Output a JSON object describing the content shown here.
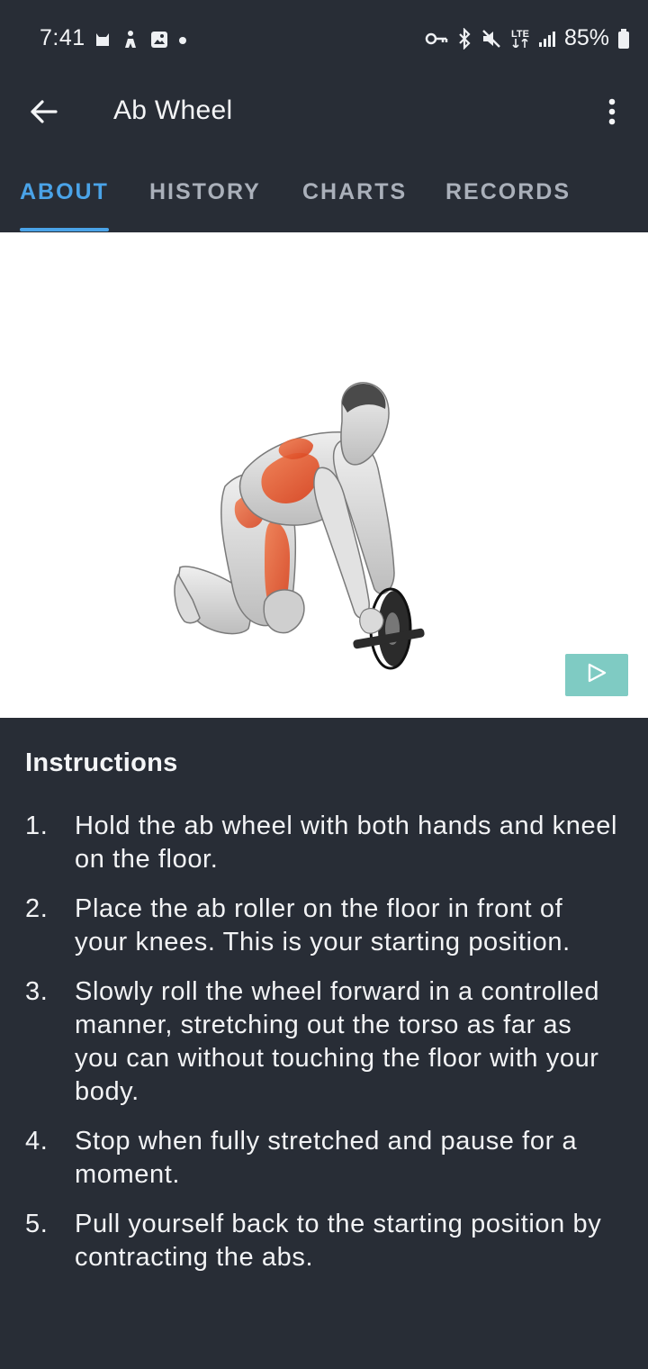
{
  "status_bar": {
    "time": "7:41",
    "battery": "85%",
    "network": "LTE",
    "left_icons": [
      "cat-notification-icon",
      "fitness-notification-icon",
      "image-notification-icon",
      "dot-notification-icon"
    ],
    "right_icons": [
      "vpn-key-icon",
      "bluetooth-icon",
      "mute-icon",
      "lte-icon",
      "signal-icon",
      "battery-icon"
    ]
  },
  "app_bar": {
    "title": "Ab Wheel",
    "back_icon": "arrow-left-icon",
    "menu_icon": "more-vertical-icon"
  },
  "tabs": [
    {
      "label": "ABOUT",
      "active": true
    },
    {
      "label": "HISTORY",
      "active": false
    },
    {
      "label": "CHARTS",
      "active": false
    },
    {
      "label": "RECORDS",
      "active": false
    }
  ],
  "media": {
    "illustration": "ab-wheel-exercise-illustration",
    "play_icon": "play-icon"
  },
  "instructions": {
    "heading": "Instructions",
    "steps": [
      {
        "number": "1.",
        "text": "Hold the ab wheel with both hands and kneel on the floor."
      },
      {
        "number": "2.",
        "text": "Place the ab roller on the floor in front of your knees. This is your starting position."
      },
      {
        "number": "3.",
        "text": "Slowly roll the wheel forward in a controlled manner, stretching out the torso as far as you can without touching the floor with your body."
      },
      {
        "number": "4.",
        "text": "Stop when fully stretched and pause for a moment."
      },
      {
        "number": "5.",
        "text": "Pull yourself back to the starting position by contracting the abs."
      }
    ]
  },
  "colors": {
    "background": "#282d36",
    "accent": "#4aa3e8",
    "tab_inactive": "#aab0ba",
    "play_button": "#7fcbc3",
    "muscle_highlight": "#e8532c"
  }
}
